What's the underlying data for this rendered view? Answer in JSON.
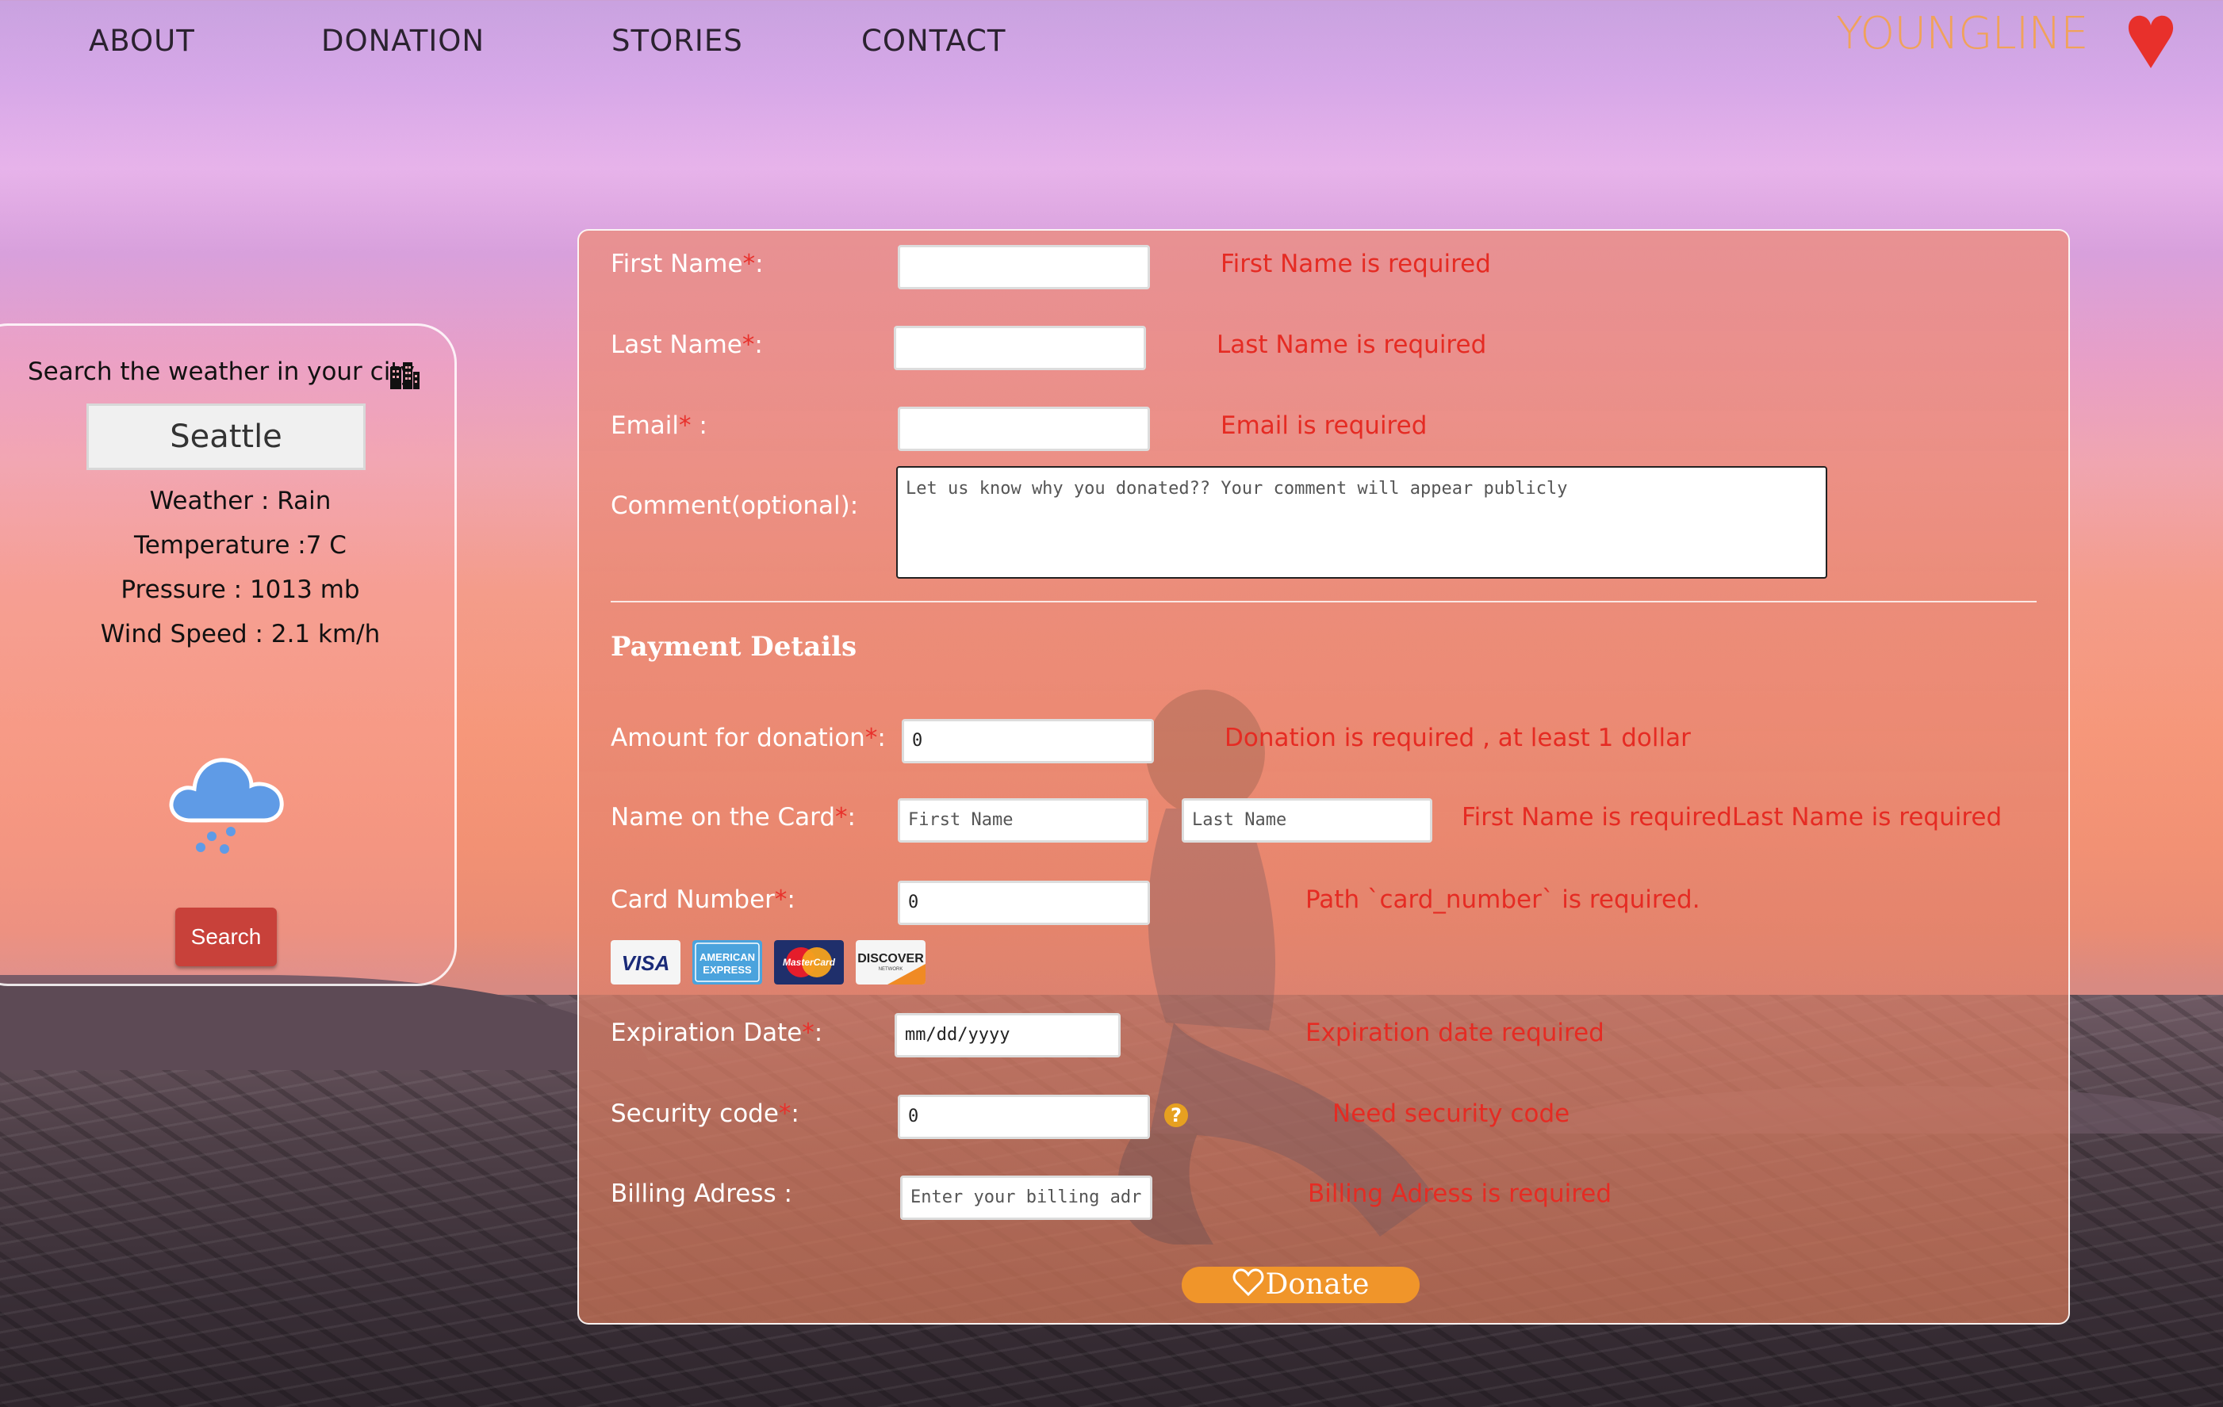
{
  "nav": {
    "items": [
      {
        "label": "ABOUT"
      },
      {
        "label": "DONATION"
      },
      {
        "label": "STORIES"
      },
      {
        "label": "CONTACT"
      }
    ],
    "logo": "YOUNGLINE"
  },
  "weather": {
    "title": "Search the weather in your city",
    "city": "Seattle",
    "condition": "Weather : Rain",
    "temperature": "Temperature :7 C",
    "pressure": "Pressure : 1013 mb",
    "wind": "Wind Speed : 2.1 km/h",
    "search_label": "Search"
  },
  "form": {
    "first_name": {
      "label": "First Name",
      "suffix": ":",
      "value": "",
      "error": "First Name is required"
    },
    "last_name": {
      "label": "Last Name",
      "suffix": ":",
      "value": "",
      "error": "Last Name is required"
    },
    "email": {
      "label": "Email",
      "suffix": " :",
      "value": "",
      "error": "Email is required"
    },
    "comment": {
      "label": "Comment(optional):",
      "placeholder": "Let us know why you donated??  Your comment will appear publicly"
    },
    "payment_title": "Payment Details",
    "amount": {
      "label": "Amount for donation",
      "suffix": ":",
      "value": "0",
      "error": "Donation is required , at least 1 dollar"
    },
    "card_name": {
      "label": "Name on the Card",
      "suffix": ":",
      "first_placeholder": "First Name",
      "last_placeholder": "Last Name",
      "error": "First Name is requiredLast Name is required"
    },
    "card_number": {
      "label": "Card Number",
      "suffix": ":",
      "value": "0",
      "error": "Path `card_number` is required."
    },
    "cards": [
      "VISA",
      "AMERICAN EXPRESS",
      "MasterCard",
      "DISCOVER"
    ],
    "expiration": {
      "label": "Expiration Date",
      "suffix": ":",
      "placeholder": "mm/dd/yyyy",
      "error": "Expiration date required"
    },
    "security": {
      "label": "Security code",
      "suffix": ":",
      "value": "0",
      "help": "?",
      "error": "Need security code"
    },
    "billing": {
      "label": "Billing Adress",
      "suffix": " :",
      "placeholder": "Enter your billing adr",
      "error": "Billing Adress is required"
    },
    "donate_label": "Donate",
    "required_mark": "*"
  },
  "colors": {
    "error": "#e52b23",
    "donate": "#f0952a",
    "logo": "#f0a25a",
    "heart": "#e8302b"
  }
}
